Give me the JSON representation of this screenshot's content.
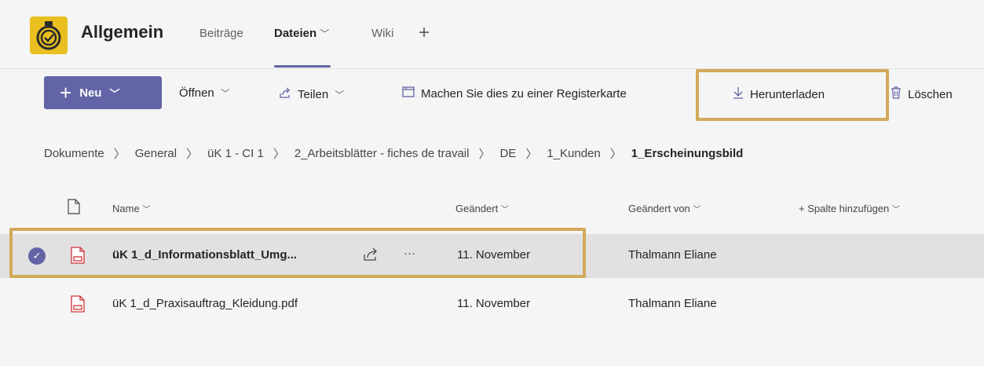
{
  "header": {
    "team_name": "Allgemein",
    "tabs": [
      {
        "label": "Beiträge"
      },
      {
        "label": "Dateien",
        "chevron": "⌵"
      },
      {
        "label": "Wiki"
      }
    ],
    "add_tab": "+"
  },
  "toolbar": {
    "new_label": "Neu",
    "open_label": "Öffnen",
    "share_label": "Teilen",
    "make_tab_label": "Machen Sie dies zu einer Registerkarte",
    "download_label": "Herunterladen",
    "delete_label": "Löschen"
  },
  "breadcrumb": [
    "Dokumente",
    "General",
    "üK 1 - CI 1",
    "2_Arbeitsblätter - fiches de travail",
    "DE",
    "1_Kunden",
    "1_Erscheinungsbild"
  ],
  "table": {
    "columns": {
      "name": "Name",
      "modified": "Geändert",
      "modified_by": "Geändert von",
      "add_column": "+ Spalte hinzufügen"
    },
    "rows": [
      {
        "name": "üK 1_d_Informationsblatt_Umg...",
        "modified": "11. November",
        "modified_by": "Thalmann Eliane",
        "selected": true
      },
      {
        "name": "üK 1_d_Praxisauftrag_Kleidung.pdf",
        "modified": "11. November",
        "modified_by": "Thalmann Eliane",
        "selected": false
      }
    ]
  },
  "colors": {
    "accent": "#6264a7",
    "highlight": "#d3a95a",
    "pdf": "#d13438"
  }
}
